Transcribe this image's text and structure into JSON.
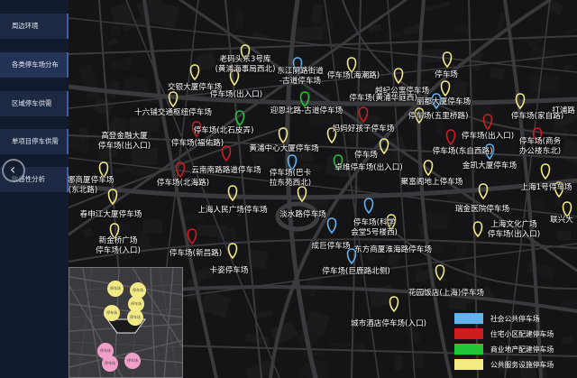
{
  "sidebar": {
    "items": [
      {
        "label": "周边环境",
        "active": false
      },
      {
        "label": "各类停车场分布",
        "active": true
      },
      {
        "label": "区域停车供需",
        "active": false
      },
      {
        "label": "单项目停车供需",
        "active": false
      },
      {
        "label": "敏感性分析",
        "active": false
      }
    ],
    "back_icon": "chevron-left-icon"
  },
  "map": {
    "labels": [
      {
        "text": "老码头东3号库\n(黄浦海事局西北)"
      },
      {
        "text": "东江阴路街道\n-古道停车场"
      },
      {
        "text": "停车场(海潮路)"
      },
      {
        "text": "停车场"
      },
      {
        "text": "交银大厦停车场"
      },
      {
        "text": "停车场(出入口)"
      },
      {
        "text": "越纪公寓停车场"
      },
      {
        "text": "停车场(黄浦华庭西)"
      },
      {
        "text": "丽都大厦停车场"
      },
      {
        "text": "十六铺交通枢纽停车场"
      },
      {
        "text": "迎恩北路-古道停车场"
      },
      {
        "text": "停车场(五里桥路)"
      },
      {
        "text": "停车场(家自路)"
      },
      {
        "text": "打浦路"
      },
      {
        "text": "妈妈好孩子停车场"
      },
      {
        "text": "停车场(北石皮弄)"
      },
      {
        "text": "停车场(出入口)"
      },
      {
        "text": "停车场(商务\n办公楼东北)"
      },
      {
        "text": "高登金融大厦\n停车场(出入口)"
      },
      {
        "text": "停车场(福佑路)"
      },
      {
        "text": "黄浦中心大厦停车场"
      },
      {
        "text": "停车场(东自西路)"
      },
      {
        "text": "停车场"
      },
      {
        "text": "金凯大厦停车场"
      },
      {
        "text": "云南南路路道停车场"
      },
      {
        "text": "停车场(巴卡\n拉东苑西北)"
      },
      {
        "text": "卓维停车场(出入口)"
      },
      {
        "text": "聚富阁地上停车场"
      },
      {
        "text": "上海1号停车场"
      },
      {
        "text": "圣德娜商厦停车场\n(东北路)"
      },
      {
        "text": "停车场(北海路)"
      },
      {
        "text": "春申江大厦停车场"
      },
      {
        "text": "上海人民广场停车场"
      },
      {
        "text": "淡水路停车场"
      },
      {
        "text": "停车场(科学\n会堂5号楼西)"
      },
      {
        "text": "瑞金医院停车场"
      },
      {
        "text": "上海文化广场\n停车场(出入口)"
      },
      {
        "text": "联兴大"
      },
      {
        "text": "新金桥广场\n停车场(入口)"
      },
      {
        "text": "停车场(新昌路)"
      },
      {
        "text": "成巨停车场"
      },
      {
        "text": "东方商厦淮海路停车场"
      },
      {
        "text": "卡姿停车场"
      },
      {
        "text": "停车场(巨鹿路北侧)"
      },
      {
        "text": "花园饭店(上海)停车场"
      },
      {
        "text": "城市酒店停车场(入口)"
      }
    ]
  },
  "legend": {
    "items": [
      {
        "label": "社会公共停车场",
        "color": "#62b4f0"
      },
      {
        "label": "住宅小区配建停车场",
        "color": "#cc1e1e"
      },
      {
        "label": "商业地产配建停车场",
        "color": "#22c638"
      },
      {
        "label": "公共服务设施停车场",
        "color": "#f4ea84"
      }
    ]
  },
  "minimap": {
    "labels": [
      "停车场",
      "停车场",
      "停车场",
      "停车场",
      "停车场",
      "停车场",
      "停车场",
      "停车场"
    ]
  }
}
